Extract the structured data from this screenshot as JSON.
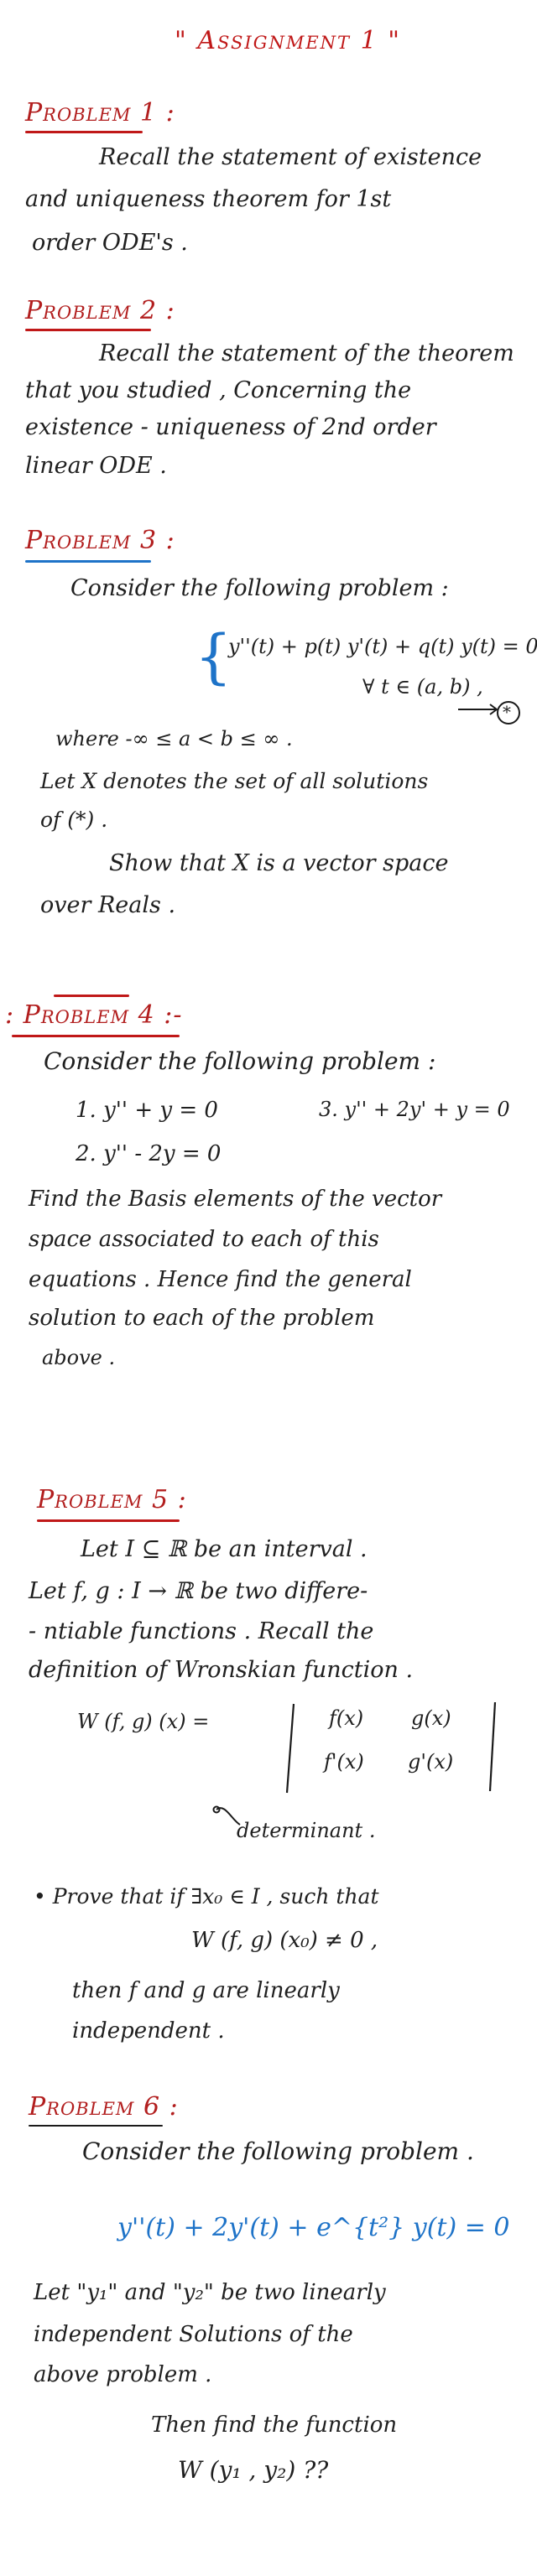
{
  "title": "\" Assignment 1 \"",
  "problem1": {
    "heading": "Problem 1 :",
    "lines": [
      "Recall the statement of existence",
      "and uniqueness theorem for 1st",
      "order ODE's ."
    ]
  },
  "problem2": {
    "heading": "Problem 2 :",
    "lines": [
      "Recall the statement of the theorem",
      "that you studied , Concerning the",
      "existence - uniqueness of 2nd order",
      "linear ODE ."
    ]
  },
  "problem3": {
    "heading": "Problem 3 :",
    "intro": "Consider the following problem :",
    "equation": "y''(t) + p(t) y'(t) + q(t) y(t) = 0 ,",
    "forall": "∀  t ∈ (a, b) ,",
    "marker": "*",
    "where": "where   -∞ ≤ a < b ≤ ∞ .",
    "let_line1": "Let  X  denotes the set of all solutions",
    "let_line2": "of  (*) .",
    "show_line1": "Show that  X  is a vector space",
    "show_line2": "over Reals ."
  },
  "problem4": {
    "heading": ": Problem 4 :-",
    "intro": "Consider the following problem :",
    "eq1": "1.  y'' + y = 0",
    "eq3": "3.  y'' + 2y' + y = 0",
    "eq2": "2.  y'' - 2y = 0",
    "lines": [
      "Find the Basis elements of the vector",
      "space associated to each of this",
      "equations . Hence find the general",
      "solution to each of the problem",
      "above ."
    ]
  },
  "problem5": {
    "heading": "Problem 5 :",
    "lines": [
      "Let  I ⊆ ℝ  be an  interval .",
      "Let f, g : I → ℝ  be two differe-",
      "- ntiable functions .  Recall the",
      "definition of  Wronskian function ."
    ],
    "wronskian_lhs": "W (f, g) (x) =",
    "matrix": [
      "f(x)",
      "g(x)",
      "f'(x)",
      "g'(x)"
    ],
    "determinant_note": "determinant .",
    "prove_line": "•  Prove that  if  ∃x₀ ∈ I , such that",
    "condition": "W (f, g) (x₀) ≠ 0 ,",
    "then_line1": "then  f  and  g  are  linearly",
    "then_line2": "independent ."
  },
  "problem6": {
    "heading": "Problem 6 :",
    "intro": "Consider the following problem .",
    "equation": "y''(t) + 2y'(t) + e^{t²} y(t) = 0",
    "lines": [
      "Let  \"y₁\"  and  \"y₂\"  be  two  linearly",
      "independent  Solutions of the",
      "above  problem .",
      "Then find  the  function",
      "W (y₁ , y₂)   ??"
    ]
  },
  "colors": {
    "ink": "#1f1f1f",
    "heading": "#b21e1e",
    "accent_blue": "#1e73c8"
  }
}
